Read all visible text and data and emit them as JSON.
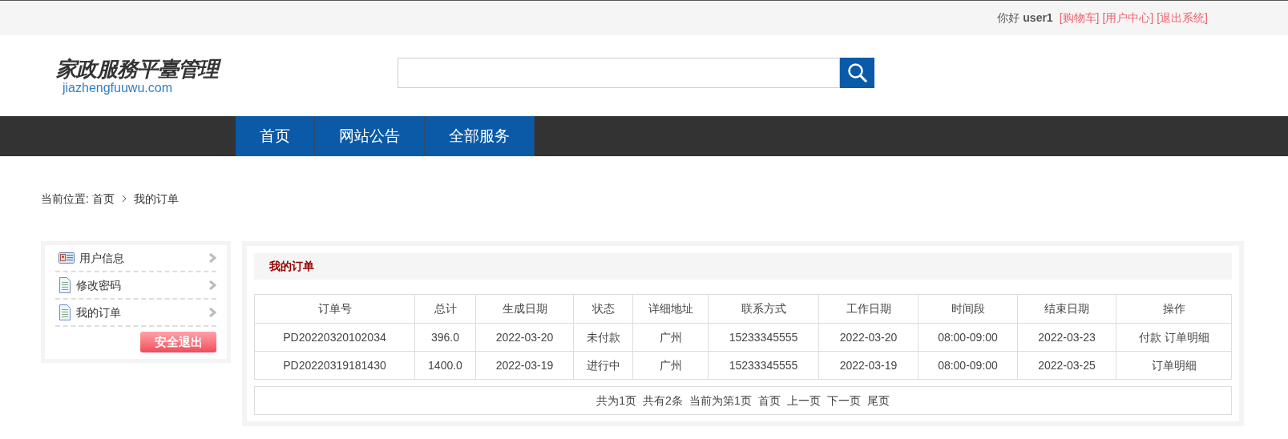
{
  "top_bar": {
    "greeting": "你好",
    "username": "user1",
    "links": [
      "[购物车]",
      "[用户中心]",
      "[退出系统]"
    ]
  },
  "logo": {
    "title": "家政服務平臺管理",
    "domain": "jiazhengfuuwu.com"
  },
  "nav": [
    "首页",
    "网站公告",
    "全部服务"
  ],
  "breadcrumb": {
    "label": "当前位置:",
    "items": [
      "首页",
      "我的订单"
    ]
  },
  "sidebar": {
    "items": [
      {
        "label": "用户信息",
        "kind": "card"
      },
      {
        "label": "修改密码",
        "kind": "document"
      },
      {
        "label": "我的订单",
        "kind": "document"
      }
    ],
    "logout": "安全退出"
  },
  "panel": {
    "title": "我的订单",
    "table": {
      "columns": [
        "订单号",
        "总计",
        "生成日期",
        "状态",
        "详细地址",
        "联系方式",
        "工作日期",
        "时间段",
        "结束日期",
        "操作"
      ],
      "rows": [
        {
          "cells": [
            "PD20220320102034",
            "396.0",
            "2022-03-20",
            "未付款",
            "广州",
            "15233345555",
            "2022-03-20",
            "08:00-09:00",
            "2022-03-23"
          ],
          "actions": [
            "付款",
            "订单明细"
          ]
        },
        {
          "cells": [
            "PD20220319181430",
            "1400.0",
            "2022-03-19",
            "进行中",
            "广州",
            "15233345555",
            "2022-03-19",
            "08:00-09:00",
            "2022-03-25"
          ],
          "actions": [
            "订单明细"
          ]
        }
      ]
    },
    "pagination": {
      "info": [
        "共为1页",
        "共有2条",
        "当前为第1页"
      ],
      "links": [
        "首页",
        "上一页",
        "下一页",
        "尾页"
      ]
    }
  }
}
